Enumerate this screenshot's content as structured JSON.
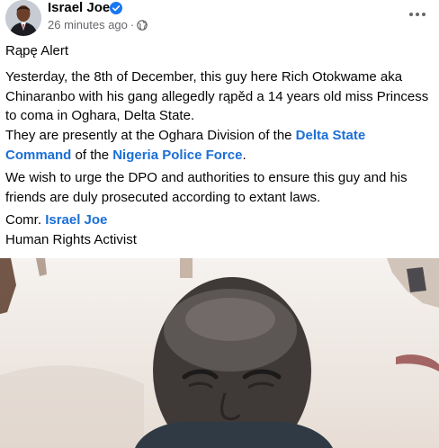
{
  "post": {
    "author": "Israel Joe",
    "timestamp": "26 minutes ago",
    "separator": "·",
    "audience_icon": "globe-icon",
    "menu_icon": "more-options-icon",
    "verified_icon": "verified-badge-icon",
    "verified_color": "#1877f2",
    "link_color": "#1b6fd6"
  },
  "body": {
    "title": "Rąpę Alert",
    "para1": "Yesterday, the 8th of December, this guy here Rich Otokwame aka Chinaranbo with his gang allegedly rąpěd a 14 years old miss Princess to coma in Oghara, Delta State.",
    "para2_before": "They are presently at the Oghara Division of the ",
    "para2_link1": "Delta State Command",
    "para2_middle": " of the ",
    "para2_link2": "Nigeria Police Force",
    "para2_after": ".",
    "para3": "We wish to urge the DPO and authorities to ensure this guy and his friends are duly prosecuted according to extant laws.",
    "sign_prefix": "Comr. ",
    "sign_link": "Israel Joe",
    "sign_role": "Human Rights Activist"
  }
}
